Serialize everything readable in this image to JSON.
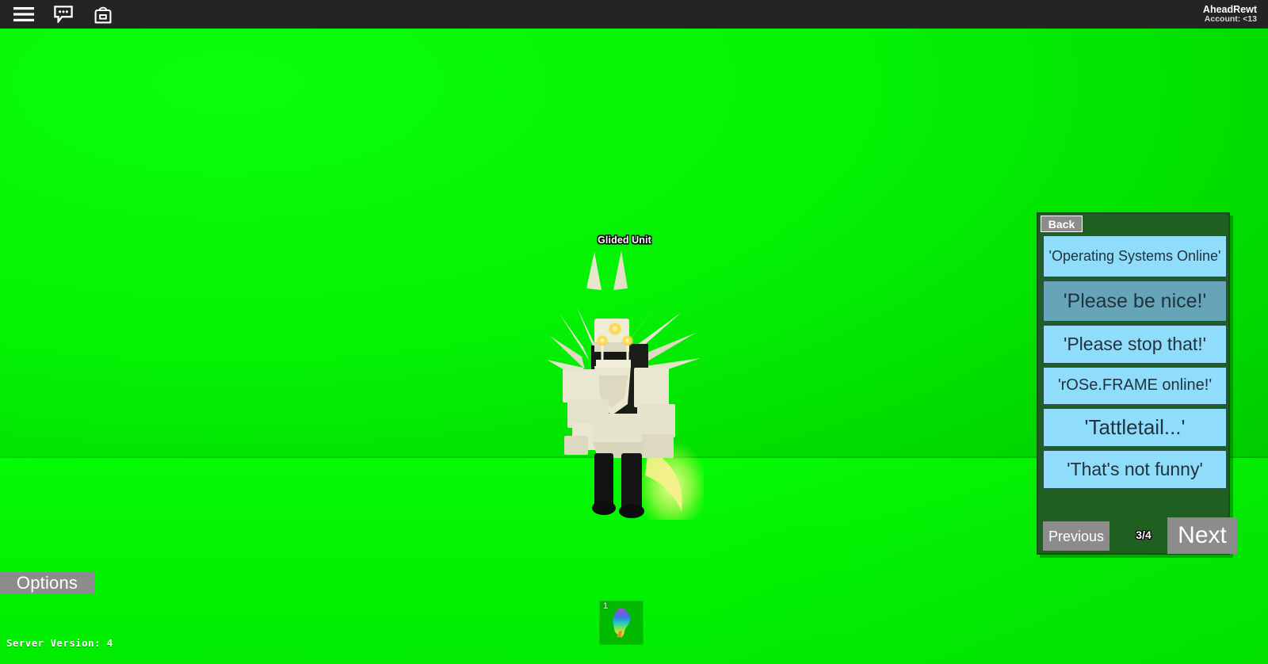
{
  "topbar": {
    "icons": [
      {
        "name": "hamburger-menu-icon",
        "label": "Menu"
      },
      {
        "name": "chat-icon",
        "label": "Chat"
      },
      {
        "name": "backpack-icon",
        "label": "Backpack"
      }
    ],
    "account": {
      "username": "AheadRewt",
      "account_label": "Account: <13"
    }
  },
  "world": {
    "background_color": "#00f000",
    "ground_color": "#04f404",
    "character": {
      "display_name": "Glided Unit",
      "armor_color": "#e8e6cd",
      "armor_shadow_color": "#c9c7ab",
      "leg_color": "#141414",
      "eye_glow_color": "#ffd84a",
      "aura_color": "#f5f07a"
    }
  },
  "options_button": {
    "label": "Options"
  },
  "server_version": {
    "text": "Server Version: 4"
  },
  "hotbar": {
    "slots": [
      {
        "number": "1",
        "item_name": "rainbow-flame-item"
      }
    ]
  },
  "dialogue_panel": {
    "back_label": "Back",
    "panel_color": "#1f5f1f",
    "choice_color": "#8fdcfb",
    "choice_selected_color": "#66a4b8",
    "choices": [
      {
        "text": "'Operating Systems Online'",
        "selected": false
      },
      {
        "text": "'Please be nice!'",
        "selected": true
      },
      {
        "text": "'Please stop that!'",
        "selected": false
      },
      {
        "text": "'rOSe.FRAME online!'",
        "selected": false
      },
      {
        "text": "'Tattletail...'",
        "selected": false
      },
      {
        "text": "'That's not funny'",
        "selected": false
      }
    ],
    "nav": {
      "previous_label": "Previous",
      "page_indicator": "3/4",
      "next_label": "Next"
    }
  }
}
